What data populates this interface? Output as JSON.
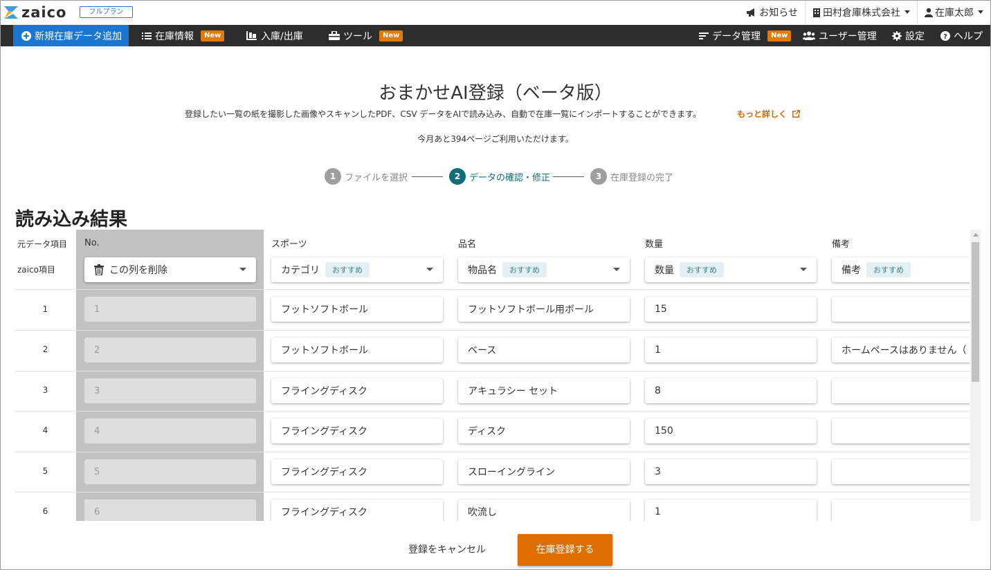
{
  "app": {
    "logo_text": "zaico",
    "plan_badge": "フルプラン"
  },
  "topbar": {
    "notice_label": "お知らせ",
    "company_label": "田村倉庫株式会社",
    "user_label": "在庫太郎"
  },
  "nav": {
    "add_label": "新規在庫データ追加",
    "inventory_label": "在庫情報",
    "inout_label": "入庫/出庫",
    "tools_label": "ツール",
    "data_mgmt_label": "データ管理",
    "user_mgmt_label": "ユーザー管理",
    "settings_label": "設定",
    "help_label": "ヘルプ",
    "new_badge": "New"
  },
  "page": {
    "title": "おまかせAI登録（ベータ版）",
    "description": "登録したい一覧の紙を撮影した画像やスキャンしたPDF、CSV データをAIで読み込み、自動で在庫一覧にインポートすることができます。",
    "more_link": "もっと詳しく",
    "remaining": "今月あと394ページご利用いただけます。",
    "section_title": "読み込み結果"
  },
  "stepper": {
    "steps": [
      {
        "num": "1",
        "label": "ファイルを選択"
      },
      {
        "num": "2",
        "label": "データの確認・修正"
      },
      {
        "num": "3",
        "label": "在庫登録の完了"
      }
    ]
  },
  "table": {
    "left_labels": {
      "source": "元データ項目",
      "zaico": "zaico項目"
    },
    "columns": [
      {
        "source": "No.",
        "mapping": "この列を削除",
        "chip": ""
      },
      {
        "source": "スポーツ",
        "mapping": "カテゴリ",
        "chip": "おすすめ"
      },
      {
        "source": "品名",
        "mapping": "物品名",
        "chip": "おすすめ"
      },
      {
        "source": "数量",
        "mapping": "数量",
        "chip": "おすすめ"
      },
      {
        "source": "備考",
        "mapping": "備考",
        "chip": "おすすめ"
      }
    ],
    "rows": [
      {
        "num": "1",
        "cells": [
          "1",
          "フットソフトボール",
          "フットソフトボール用ボール",
          "15",
          ""
        ]
      },
      {
        "num": "2",
        "cells": [
          "2",
          "フットソフトボール",
          "ベース",
          "1",
          "ホームペースはありません（"
        ]
      },
      {
        "num": "3",
        "cells": [
          "3",
          "フライングディスク",
          "アキュラシー セット",
          "8",
          ""
        ]
      },
      {
        "num": "4",
        "cells": [
          "4",
          "フライングディスク",
          "ディスク",
          "150",
          ""
        ]
      },
      {
        "num": "5",
        "cells": [
          "5",
          "フライングディスク",
          "スローイングライン",
          "3",
          ""
        ]
      },
      {
        "num": "6",
        "cells": [
          "6",
          "フライングディスク",
          "吹流し",
          "1",
          ""
        ]
      }
    ]
  },
  "footer": {
    "cancel_label": "登録をキャンセル",
    "submit_label": "在庫登録する"
  },
  "colors": {
    "accent_blue": "#1976d2",
    "nav_dark": "#2d2d2d",
    "badge_orange": "#e07a00",
    "step_active": "#0f6e78",
    "submit_orange": "#dd6e00"
  }
}
